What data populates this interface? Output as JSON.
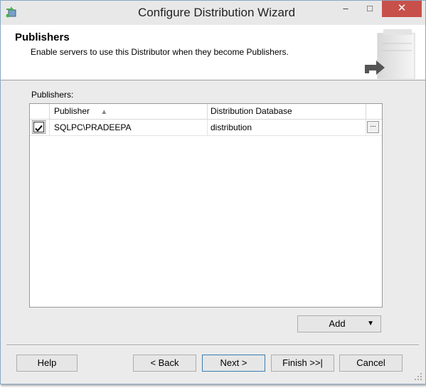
{
  "window": {
    "title": "Configure Distribution Wizard"
  },
  "titlebar": {
    "minimize": "–",
    "maximize": "□",
    "close": "✕"
  },
  "header": {
    "title": "Publishers",
    "subtitle": "Enable servers to use this Distributor when they become Publishers."
  },
  "publishers": {
    "label": "Publishers:",
    "columns": {
      "publisher": "Publisher",
      "distribution_db": "Distribution Database"
    },
    "sort_indicator": "▲",
    "rows": [
      {
        "checked": true,
        "publisher": "SQLPC\\PRADEEPA",
        "distribution_db": "distribution",
        "browse": "..."
      }
    ]
  },
  "buttons": {
    "add": "Add",
    "add_arrow": "▼",
    "help": "Help",
    "back": "< Back",
    "next": "Next >",
    "finish": "Finish >>|",
    "cancel": "Cancel"
  },
  "colors": {
    "close_button": "#c7504b",
    "default_button_border": "#3c7fb1"
  }
}
